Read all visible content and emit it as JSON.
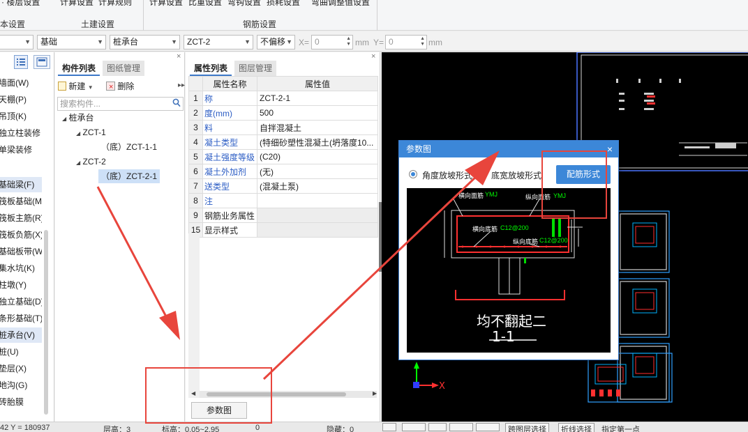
{
  "ribbon": {
    "top_items": [
      "· 楼层设置",
      "计算设置",
      "计算规则",
      "计算设置",
      "比重设置",
      "弯钩设置",
      "损耗设置",
      "弯曲调整值设置"
    ],
    "groups": [
      "本设置",
      "土建设置",
      "钢筋设置"
    ]
  },
  "toolbar": {
    "floor_combo": "",
    "category_combo": "基础",
    "type_combo": "桩承台",
    "component_combo": "ZCT-2",
    "offset_combo": "不偏移",
    "x_label": "X=",
    "x_value": "0",
    "y_label": "Y=",
    "y_value": "0",
    "unit_x": "mm",
    "unit_y": "mm"
  },
  "leftnav": {
    "items": [
      {
        "label": "墙面(W)",
        "highlight": false
      },
      {
        "label": "天棚(P)",
        "highlight": false
      },
      {
        "label": "吊顶(K)",
        "highlight": false
      },
      {
        "label": "独立柱装修",
        "highlight": false
      },
      {
        "label": "单梁装修",
        "highlight": false
      },
      {
        "label": "基础梁(F)",
        "highlight": true
      },
      {
        "label": "筏板基础(M)",
        "highlight": false
      },
      {
        "label": "筏板主筋(R)",
        "highlight": false
      },
      {
        "label": "筏板负筋(X)",
        "highlight": false
      },
      {
        "label": "基础板带(W)",
        "highlight": false
      },
      {
        "label": "集水坑(K)",
        "highlight": false
      },
      {
        "label": "柱墩(Y)",
        "highlight": false
      },
      {
        "label": "独立基础(D)",
        "highlight": false
      },
      {
        "label": "条形基础(T)",
        "highlight": false
      },
      {
        "label": "桩承台(V)",
        "highlight": true
      },
      {
        "label": "桩(U)",
        "highlight": false
      },
      {
        "label": "垫层(X)",
        "highlight": false
      },
      {
        "label": "地沟(G)",
        "highlight": false
      },
      {
        "label": "砖胎膜",
        "highlight": false
      }
    ]
  },
  "comp": {
    "tab_active": "构件列表",
    "tab_inactive": "图纸管理",
    "new_label": "新建",
    "delete_label": "删除",
    "search_placeholder": "搜索构件...",
    "tree": {
      "root": "桩承台",
      "n1": "ZCT-1",
      "n1c": "（底）ZCT-1-1",
      "n2": "ZCT-2",
      "n2c": "（底）ZCT-2-1"
    }
  },
  "props": {
    "tab_active": "属性列表",
    "tab_inactive": "图层管理",
    "col_name": "属性名称",
    "col_value": "属性值",
    "rows": [
      {
        "num": "1",
        "name": "称",
        "value": "ZCT-2-1",
        "blue": true,
        "grey": false
      },
      {
        "num": "2",
        "name": "度(mm)",
        "value": "500",
        "blue": true,
        "grey": false
      },
      {
        "num": "3",
        "name": "料",
        "value": "自拌混凝土",
        "blue": true,
        "grey": false
      },
      {
        "num": "4",
        "name": "凝土类型",
        "value": "(特细砂塑性混凝土(坍落度10...",
        "blue": true,
        "grey": false
      },
      {
        "num": "5",
        "name": "凝土强度等级",
        "value": "(C20)",
        "blue": true,
        "grey": false
      },
      {
        "num": "6",
        "name": "凝土外加剂",
        "value": "(无)",
        "blue": true,
        "grey": false
      },
      {
        "num": "7",
        "name": "送类型",
        "value": "(混凝土泵)",
        "blue": true,
        "grey": false
      },
      {
        "num": "8",
        "name": "注",
        "value": "",
        "blue": true,
        "grey": false
      },
      {
        "num": "9",
        "name": "钢筋业务属性",
        "value": "",
        "blue": false,
        "grey": true
      },
      {
        "num": "15",
        "name": "显示样式",
        "value": "",
        "blue": false,
        "grey": true
      }
    ],
    "param_button": "参数图"
  },
  "dialog": {
    "title": "参数图",
    "close": "×",
    "radio1": "角度放坡形式",
    "radio2": "底宽放坡形式",
    "button": "配筋形式",
    "drawing": {
      "top_label_1": "横向面筋",
      "top_code_1": "YMJ",
      "top_label_2": "纵向面筋",
      "top_code_2": "YMJ",
      "mid_label_1": "横向底筋",
      "mid_code_1": "C12@200",
      "mid_label_2": "纵向底筋",
      "mid_code_2": "C12@200",
      "caption": "均不翻起二",
      "section": "1-1"
    }
  },
  "status": {
    "coord": "42 Y = 180937",
    "floor_h": "层高：3",
    "elev": "标高：0.05~2.95",
    "zero": "0",
    "hidden": "隐藏：0",
    "btn1": "跨图层选择",
    "btn2": "折线选择",
    "hint": "指定第一点"
  },
  "colors": {
    "accent": "#3c87d8",
    "annotation_red": "#e8453c",
    "cad_green": "#00ff00",
    "cad_red": "#ff3030"
  }
}
